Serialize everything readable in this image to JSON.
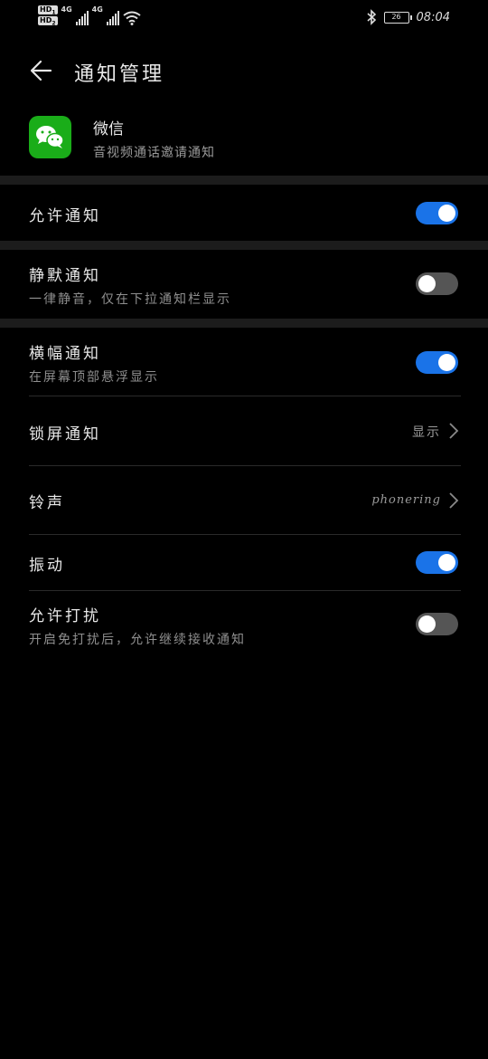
{
  "status_bar": {
    "hd1": "HD",
    "hd2": "HD",
    "sim_index_1": "1",
    "sim_index_2": "2",
    "net1": "4G",
    "net2": "4G",
    "battery": "26",
    "time": "08:04"
  },
  "header": {
    "title": "通知管理"
  },
  "app": {
    "name": "微信",
    "description": "音视频通话邀请通知",
    "icon_color": "#1aad19"
  },
  "settings": {
    "allow_notifications": {
      "label": "允许通知",
      "enabled": true
    },
    "silent": {
      "label": "静默通知",
      "sub": "一律静音，仅在下拉通知栏显示",
      "enabled": false
    },
    "banner": {
      "label": "横幅通知",
      "sub": "在屏幕顶部悬浮显示",
      "enabled": true
    },
    "lock_screen": {
      "label": "锁屏通知",
      "value": "显示"
    },
    "ringtone": {
      "label": "铃声",
      "value": "phonering"
    },
    "vibration": {
      "label": "振动",
      "enabled": true
    },
    "dnd": {
      "label": "允许打扰",
      "sub": "开启免打扰后，允许继续接收通知",
      "enabled": false
    }
  },
  "colors": {
    "accent": "#1a73e8",
    "toggle_off": "#555555",
    "background": "#000000",
    "separator": "#1c1c1c"
  }
}
